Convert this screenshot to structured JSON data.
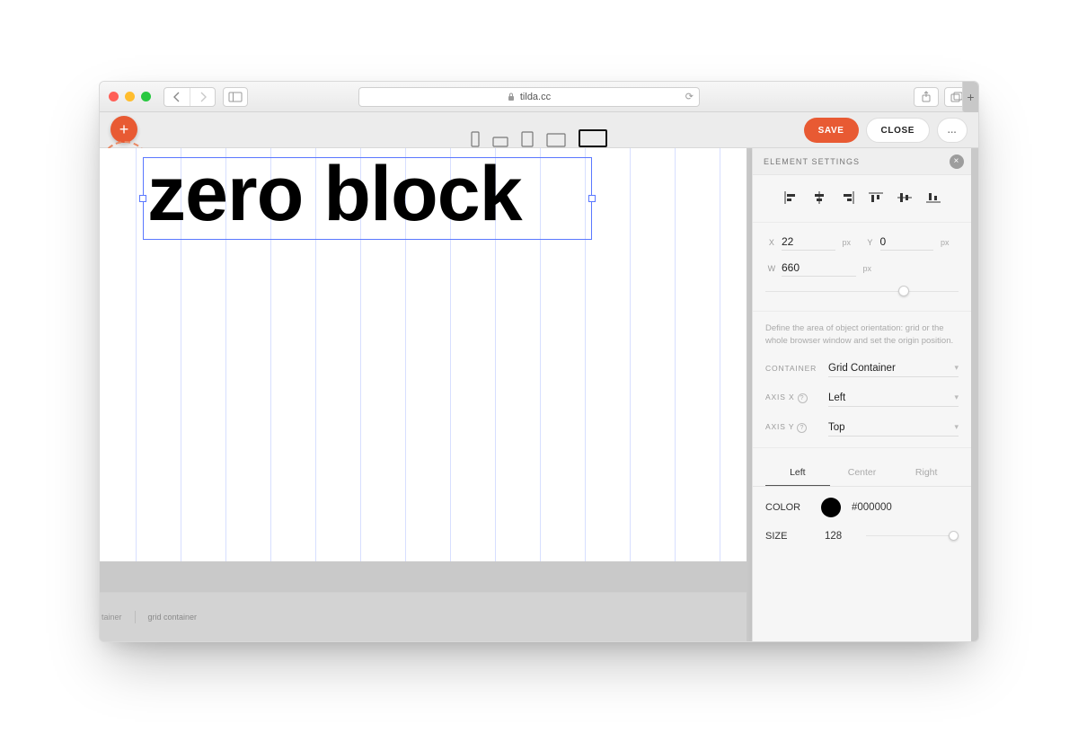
{
  "browser": {
    "url": "tilda.cc"
  },
  "toolbar": {
    "save_label": "SAVE",
    "close_label": "CLOSE",
    "more_label": "..."
  },
  "canvas": {
    "text": "zero block",
    "footer_tainer": "tainer",
    "footer_grid": "grid container"
  },
  "panel": {
    "title": "ELEMENT SETTINGS",
    "x_label": "X",
    "x_value": "22",
    "x_unit": "px",
    "y_label": "Y",
    "y_value": "0",
    "y_unit": "px",
    "w_label": "W",
    "w_value": "660",
    "w_unit": "px",
    "note": "Define the area of object orientation: grid or the whole browser window and set the origin position.",
    "container_label": "CONTAINER",
    "container_value": "Grid Container",
    "axis_x_label": "AXIS X",
    "axis_x_value": "Left",
    "axis_y_label": "AXIS Y",
    "axis_y_value": "Top",
    "tab_left": "Left",
    "tab_center": "Center",
    "tab_right": "Right",
    "color_label": "COLOR",
    "color_value": "#000000",
    "size_label": "SIZE",
    "size_value": "128"
  }
}
